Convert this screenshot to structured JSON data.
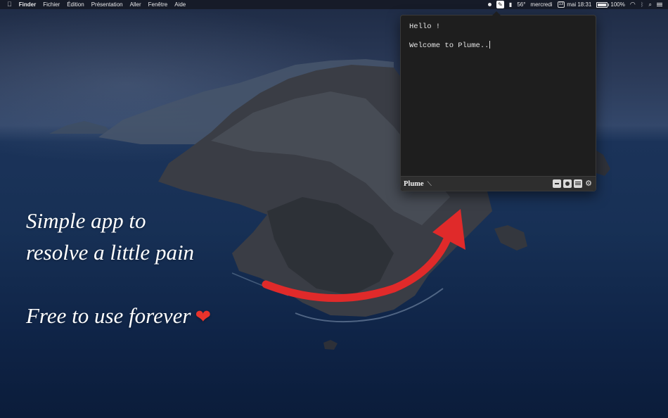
{
  "menubar": {
    "apple_icon": "apple-logo-icon",
    "app_name": "Finder",
    "menus": [
      "Fichier",
      "Édition",
      "Présentation",
      "Aller",
      "Fenêtre",
      "Aide"
    ],
    "status": {
      "temperature": "56°",
      "day": "mercredi",
      "cal_badge": "13",
      "date_time": "mai 18:31",
      "battery": "100%"
    }
  },
  "plume": {
    "lines": [
      "Hello !",
      "Welcome to Plume.."
    ],
    "brand": "Plume",
    "icons": [
      "pen-icon",
      "minimize-icon",
      "record-icon",
      "list-icon",
      "gear-icon"
    ]
  },
  "promo": {
    "line1": "Simple app to",
    "line2": "resolve a little pain",
    "line3": "Free to use forever",
    "heart": "❤"
  },
  "colors": {
    "arrow": "#e02a2a",
    "window_bg": "#1e1e1e",
    "footer_bg": "#2e2e2e"
  }
}
